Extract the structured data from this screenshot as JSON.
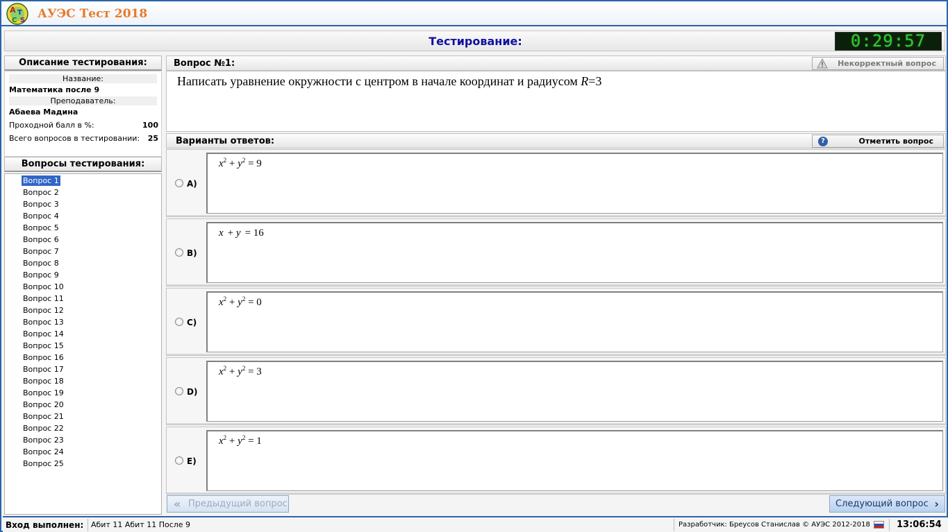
{
  "app": {
    "title": "АУЭС Тест 2018"
  },
  "header": {
    "title": "Тестирование:",
    "timer": "0:29:57"
  },
  "description": {
    "heading": "Описание тестирования:",
    "name_label": "Название:",
    "name_value": "Математика после 9",
    "teacher_label": "Преподаватель:",
    "teacher_value": "Абаева Мадина",
    "pass_label": "Проходной балл в %:",
    "pass_value": "100",
    "total_label": "Всего вопросов в тестировании:",
    "total_value": "25"
  },
  "questions_panel": {
    "heading": "Вопросы тестирования:",
    "selected_index": 0,
    "items": [
      "Вопрос 1",
      "Вопрос 2",
      "Вопрос 3",
      "Вопрос 4",
      "Вопрос 5",
      "Вопрос 6",
      "Вопрос 7",
      "Вопрос 8",
      "Вопрос 9",
      "Вопрос 10",
      "Вопрос 11",
      "Вопрос 12",
      "Вопрос 13",
      "Вопрос 14",
      "Вопрос 15",
      "Вопрос 16",
      "Вопрос 17",
      "Вопрос 18",
      "Вопрос 19",
      "Вопрос 20",
      "Вопрос 21",
      "Вопрос 22",
      "Вопрос 23",
      "Вопрос 24",
      "Вопрос 25"
    ]
  },
  "question": {
    "label": "Вопрос №1:",
    "report_button": "Некорректный вопрос",
    "text_main": "Написать уравнение окружности с центром в начале координат и радиусом ",
    "text_var": "R",
    "text_tail": "=3"
  },
  "answers": {
    "label": "Варианты ответов:",
    "mark_button": "Отметить вопрос",
    "options": [
      {
        "letter": "A)",
        "rhs": "9",
        "squares": true
      },
      {
        "letter": "B)",
        "rhs": "16",
        "squares": false
      },
      {
        "letter": "C)",
        "rhs": "0",
        "squares": true
      },
      {
        "letter": "D)",
        "rhs": "3",
        "squares": true
      },
      {
        "letter": "E)",
        "rhs": "1",
        "squares": true
      }
    ]
  },
  "nav": {
    "prev": "Предыдущий вопрос",
    "next": "Следующий вопрос"
  },
  "status": {
    "login_label": "Вход выполнен:",
    "user": "Абит 11 Абит 11 После 9",
    "developer": "Разработчик: Бреусов Станислав © АУЭС 2012-2018",
    "time": "13:06:54"
  },
  "colors": {
    "accent": "#2a63a8",
    "title_orange": "#e8792b",
    "header_blue": "#1010a0",
    "timer_green": "#35c835",
    "selection": "#3166c6"
  }
}
